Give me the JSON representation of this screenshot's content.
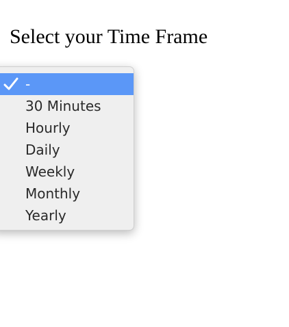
{
  "page": {
    "title": "Select your Time Frame"
  },
  "time_frame_select": {
    "selected_value": "-",
    "options": [
      {
        "label": "-",
        "selected": true
      },
      {
        "label": "30 Minutes",
        "selected": false
      },
      {
        "label": "Hourly",
        "selected": false
      },
      {
        "label": "Daily",
        "selected": false
      },
      {
        "label": "Weekly",
        "selected": false
      },
      {
        "label": "Monthly",
        "selected": false
      },
      {
        "label": "Yearly",
        "selected": false
      }
    ],
    "selected_icon": "checkmark-icon"
  },
  "colors": {
    "menu_background": "#efefef",
    "selection_highlight": "#5b97f7",
    "option_text": "#2a2a2a",
    "selected_text": "#ffffff"
  }
}
